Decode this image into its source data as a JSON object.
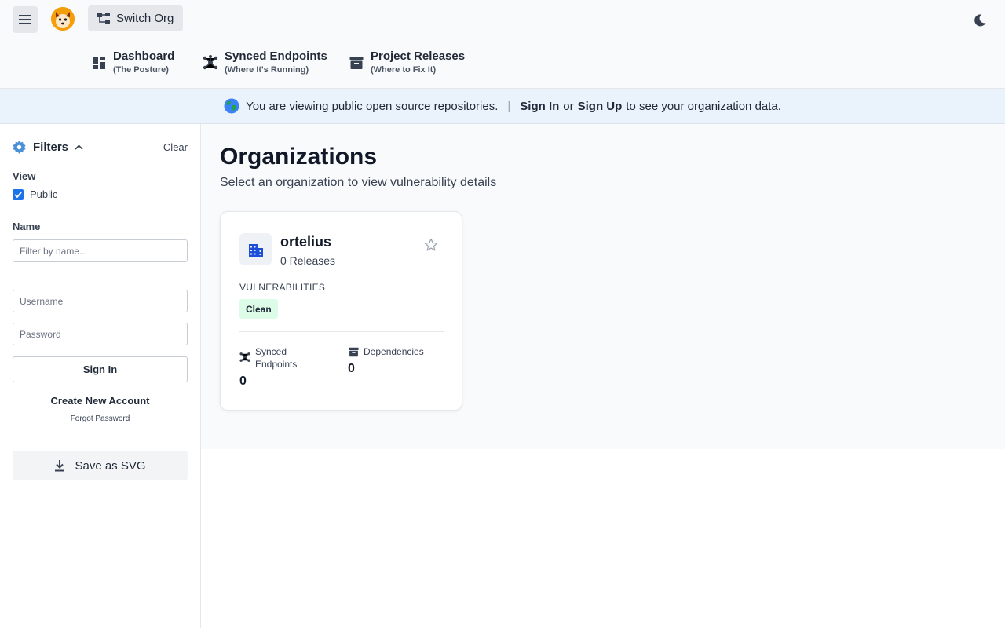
{
  "topbar": {
    "switch_org_label": "Switch Org"
  },
  "nav": [
    {
      "title": "Dashboard",
      "subtitle": "(The Posture)",
      "icon": "dashboard-icon"
    },
    {
      "title": "Synced Endpoints",
      "subtitle": "(Where It's Running)",
      "icon": "network-icon"
    },
    {
      "title": "Project Releases",
      "subtitle": "(Where to Fix It)",
      "icon": "archive-icon"
    }
  ],
  "banner": {
    "message": "You are viewing public open source repositories.",
    "separator": "|",
    "sign_in": "Sign In",
    "or": "or",
    "sign_up": "Sign Up",
    "tail": "to see your organization data."
  },
  "sidebar": {
    "filters_title": "Filters",
    "clear_label": "Clear",
    "view_label": "View",
    "public_label": "Public",
    "public_checked": true,
    "name_label": "Name",
    "name_placeholder": "Filter by name...",
    "username_placeholder": "Username",
    "password_placeholder": "Password",
    "sign_in_button": "Sign In",
    "create_account": "Create New Account",
    "forgot_password": "Forgot Password",
    "save_svg": "Save as SVG"
  },
  "main": {
    "title": "Organizations",
    "subtitle": "Select an organization to view vulnerability details",
    "cards": [
      {
        "name": "ortelius",
        "releases": "0 Releases",
        "vuln_label": "VULNERABILITIES",
        "status": "Clean",
        "synced_label_1": "Synced",
        "synced_label_2": "Endpoints",
        "synced_value": "0",
        "deps_label": "Dependencies",
        "deps_value": "0"
      }
    ]
  },
  "colors": {
    "accent": "#1a73e8",
    "badge_clean_bg": "#dcfce7",
    "banner_bg": "#eaf2fb",
    "brand_orange": "#f59e0b"
  }
}
